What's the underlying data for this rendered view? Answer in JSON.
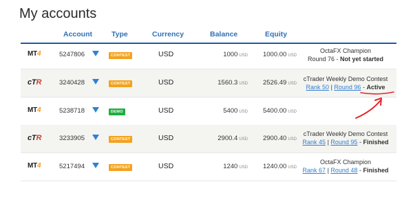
{
  "page": {
    "title": "My accounts"
  },
  "columns": {
    "account": "Account",
    "type": "Type",
    "currency": "Currency",
    "balance": "Balance",
    "equity": "Equity"
  },
  "colors": {
    "header": "#2f6fb6",
    "contest_badge": "#f3a21d",
    "demo_badge": "#1fae3f",
    "link": "#2f7ed1",
    "dropdown_arrow": "#2f80d4",
    "annotation": "#e3242b"
  },
  "unit_label": "USD",
  "rows": [
    {
      "platform": "MT4",
      "platform_prefix": "MT",
      "platform_suffix": "4",
      "account": "5247806",
      "type": "CONTEST",
      "currency": "USD",
      "balance": "1000",
      "equity": "1000.00",
      "status_line1": "OctaFX Champion",
      "status_round": "Round 76",
      "status_dash": " - ",
      "status_state": "Not yet started"
    },
    {
      "platform": "cTR",
      "platform_prefix": "cT",
      "platform_suffix": "R",
      "account": "3240428",
      "type": "CONTEST",
      "currency": "USD",
      "balance": "1560.3",
      "equity": "2526.49",
      "status_line1": "cTrader Weekly Demo Contest",
      "link_rank": "Rank 50",
      "link_round": "Round 96",
      "status_state": "Active"
    },
    {
      "platform": "MT4",
      "platform_prefix": "MT",
      "platform_suffix": "4",
      "account": "5238718",
      "type": "DEMO",
      "currency": "USD",
      "balance": "5400",
      "equity": "5400.00"
    },
    {
      "platform": "cTR",
      "platform_prefix": "cT",
      "platform_suffix": "R",
      "account": "3233905",
      "type": "CONTEST",
      "currency": "USD",
      "balance": "2900.4",
      "equity": "2900.40",
      "status_line1": "cTrader Weekly Demo Contest",
      "link_rank": "Rank 45",
      "link_round": "Round 95",
      "status_state": "Finished"
    },
    {
      "platform": "MT4",
      "platform_prefix": "MT",
      "platform_suffix": "4",
      "account": "5217494",
      "type": "CONTEST",
      "currency": "USD",
      "balance": "1240",
      "equity": "1240.00",
      "status_line1": "OctaFX Champion",
      "link_rank": "Rank 67",
      "link_round": "Round 48",
      "status_state": "Finished"
    }
  ]
}
